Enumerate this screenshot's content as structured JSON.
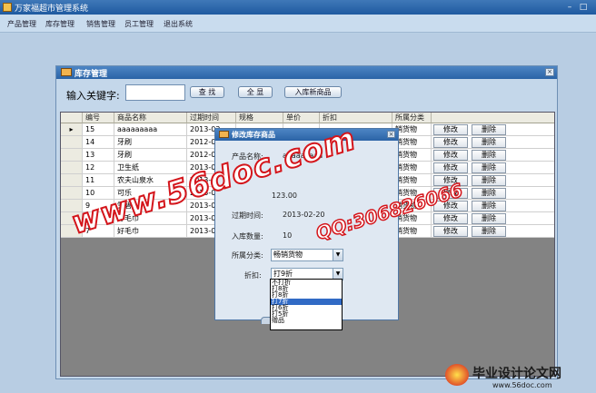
{
  "window": {
    "title": "万家福超市管理系统"
  },
  "menubar": {
    "items": [
      "产品管理",
      "库存管理",
      "销售管理",
      "员工管理",
      "退出系统"
    ]
  },
  "panel": {
    "title": "库存管理",
    "search_label": "输入关键字:",
    "search_value": "",
    "buttons": {
      "search": "查 找",
      "show_all": "全 显",
      "add_product": "入库新商品"
    }
  },
  "grid": {
    "columns": [
      "编号",
      "商品名称",
      "过期时间",
      "规格",
      "单价",
      "折扣",
      "所属分类"
    ],
    "rows": [
      [
        "15",
        "aaaaaaaaa",
        "2013-02-",
        "",
        "",
        "",
        "销货物"
      ],
      [
        "14",
        "牙刷",
        "2012-05-",
        "",
        "",
        "",
        "销货物"
      ],
      [
        "13",
        "牙刷",
        "2012-04-",
        "",
        "",
        "",
        "销货物"
      ],
      [
        "12",
        "卫生纸",
        "2013-02-",
        "",
        "",
        "",
        "销货物"
      ],
      [
        "11",
        "农夫山泉水",
        "2013-02-",
        "",
        "",
        "",
        "销货物"
      ],
      [
        "10",
        "可乐",
        "2013-02-",
        "",
        "",
        "",
        "销货物"
      ],
      [
        "9",
        "雪碧",
        "2013-02-",
        "",
        "",
        "",
        "销货物"
      ],
      [
        "8",
        "好毛巾",
        "2013-02-",
        "",
        "",
        "",
        "销货物"
      ],
      [
        "7",
        "好毛巾",
        "2013-02-",
        "",
        "",
        "",
        "销货物"
      ]
    ],
    "edit_label": "修改",
    "delete_label": "删除"
  },
  "dialog": {
    "title": "修改库存商品",
    "name_label": "产品名称:",
    "name_value": "aaaaaaaaa",
    "price_value": "123.00",
    "expiry_label": "过期时间:",
    "expiry_value": "2013-02-20",
    "qty_label": "入库数量:",
    "qty_value": "10",
    "category_label": "所属分类:",
    "category_value": "畅销货物",
    "discount_label": "折扣:",
    "discount_value": "打9折",
    "discount_options": [
      "不打折",
      "打8折",
      "打8折",
      "打7折",
      "打6折",
      "打5折",
      "赠品"
    ],
    "highlighted_option": 3
  },
  "watermark": {
    "site": "www.56doc.com",
    "qq": "QQ:306826066",
    "logo_text": "毕业设计论文网",
    "logo_url": "www.56doc.com"
  }
}
